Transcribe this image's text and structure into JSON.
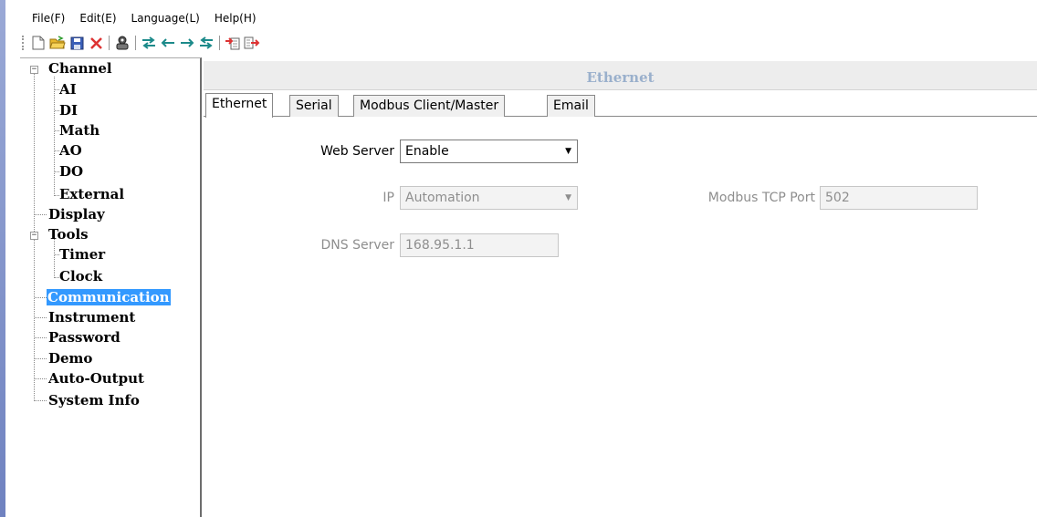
{
  "menu": {
    "file": "File(F)",
    "edit": "Edit(E)",
    "language": "Language(L)",
    "help": "Help(H)"
  },
  "toolbar": {
    "buttons": [
      "new-file-icon",
      "open-folder-icon",
      "save-icon",
      "delete-icon",
      "connect-icon",
      "transfer-both-icon",
      "arrow-left-icon",
      "arrow-right-icon",
      "transfer-all-icon",
      "import-icon",
      "export-icon"
    ]
  },
  "tree": {
    "channel": "Channel",
    "ai": "AI",
    "di": "DI",
    "math": "Math",
    "ao": "AO",
    "do": "DO",
    "external": "External",
    "display": "Display",
    "tools": "Tools",
    "timer": "Timer",
    "clock": "Clock",
    "communication": "Communication",
    "instrument": "Instrument",
    "password": "Password",
    "demo": "Demo",
    "auto_output": "Auto-Output",
    "system_info": "System Info",
    "selected": "Communication",
    "expander_symbol": "−"
  },
  "header": {
    "title": "Ethernet"
  },
  "tabs": {
    "ethernet": "Ethernet",
    "serial": "Serial",
    "modbus": "Modbus Client/Master",
    "email": "Email",
    "active": "Ethernet"
  },
  "form": {
    "web_server_label": "Web Server",
    "web_server_value": "Enable",
    "ip_label": "IP",
    "ip_value": "Automation",
    "modbus_port_label": "Modbus TCP Port",
    "modbus_port_value": "502",
    "dns_label": "DNS Server",
    "dns_value": "168.95.1.1",
    "dropdown_arrow": "▼"
  },
  "colors": {
    "selection": "#3399ff",
    "header_text": "#9ab0cc",
    "disabled_text": "#8e8e8e"
  }
}
